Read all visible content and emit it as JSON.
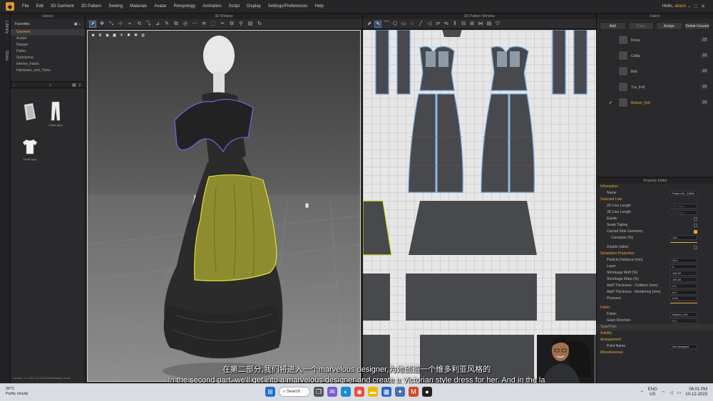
{
  "menubar": {
    "items": [
      "File",
      "Edit",
      "3D Garment",
      "2D Pattern",
      "Sewing",
      "Materials",
      "Avatar",
      "Retopology",
      "Animation",
      "Script",
      "Display",
      "Settings/Preferences",
      "Help"
    ],
    "greeting": "Hello,",
    "username": "akash"
  },
  "sidestrip": {
    "tabs": [
      "Library",
      "Store"
    ]
  },
  "library": {
    "title": "Library",
    "favorites_label": "Favorites",
    "items": [
      "Garment",
      "Avatar",
      "Hanger",
      "Fabric",
      "Substance",
      "Interior_Fabric",
      "Hardware_and_Trims"
    ],
    "thumbs": [
      "",
      "Pants (Ipp)",
      "Tshirt (Ipp)"
    ],
    "version": "Version : 6.1.861 (r37223)    Wednesday_Dress"
  },
  "view3d": {
    "title": "3D Window"
  },
  "view2d": {
    "title": "2D Pattern Window"
  },
  "object_browser": {
    "title": "Fabric",
    "buttons": [
      "Add",
      "Copy",
      "Assign",
      "Delete Unused"
    ],
    "fabrics": [
      {
        "name": "Dress",
        "count": "22"
      },
      {
        "name": "Collar",
        "count": "22"
      },
      {
        "name": "Belt",
        "count": "22"
      },
      {
        "name": "Tux_Frill",
        "count": "22"
      },
      {
        "name": "Bottom_Frill",
        "count": "22",
        "selected": true
      }
    ]
  },
  "property_editor": {
    "title": "Property Editor",
    "sections": {
      "information": "Information",
      "selected_line": "Selected Line",
      "simulation": "Simulation Properties",
      "fabric": "Fabric",
      "solidify": "Solidify",
      "arrangement": "Arrangement",
      "miscellaneous": "Miscellaneous",
      "tuck_trim": "Tuck/Trim"
    },
    "name_label": "Name",
    "name_value": "Pattern2D_33854",
    "line_2d": "2D Line Length",
    "line_2d_val": "235.32cm",
    "line_3d": "3D Line Length",
    "line_3d_val": "235.32cm",
    "elastic": "Elastic",
    "seam_taping": "Seam Taping",
    "curved_fold": "Curved Side Geometry",
    "curvature": "Curvature (%)",
    "curvature_val": "100",
    "double_sided": "Double Sided",
    "particle": "Particle Distance (mm)",
    "particle_val": "20.0",
    "layer": "Layer",
    "layer_val": "0",
    "shrink_weft": "Shrinkage Weft (%)",
    "shrink_weft_val": "100.00",
    "shrink_warp": "Shrinkage Warp (%)",
    "shrink_warp_val": "100.00",
    "add_thick_col": "Add'l Thickness - Collision (mm)",
    "add_thick_col_val": "2.5",
    "add_thick_ren": "Add'l Thickness - Rendering (mm)",
    "add_thick_ren_val": "0.0",
    "pressure": "Pressure",
    "pressure_val": "0.00",
    "fabric_label": "Fabric",
    "fabric_val": "Bottom_Frill",
    "grain": "Grain Direction",
    "grain_val": "0.0",
    "point_name": "Point Name",
    "point_name_val": "Not assigned"
  },
  "subtitles": {
    "zh": "在第二部分,我们将进入一个marvelous designer,为她创造一个维多利亚风格的",
    "en": "In the second part. we'll get into a marvelous designer and create a Victorian style dress for her. And in the la"
  },
  "taskbar": {
    "temp": "26°C",
    "weather": "Partly cloudy",
    "search": "Search",
    "lang1": "ENG",
    "lang2": "US",
    "time": "06:01 PM",
    "date": "10-12-2023"
  }
}
